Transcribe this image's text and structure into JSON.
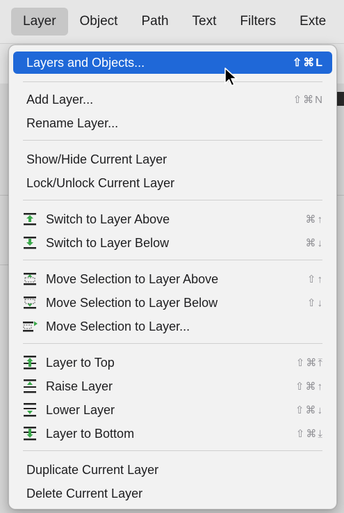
{
  "menubar": {
    "items": [
      "Layer",
      "Object",
      "Path",
      "Text",
      "Filters",
      "Exte"
    ]
  },
  "menu": {
    "items": [
      {
        "label": "Layers and Objects...",
        "shortcut": "⇧⌘L",
        "icon": ""
      },
      {
        "label": "Add Layer...",
        "shortcut": "⇧⌘N",
        "icon": ""
      },
      {
        "label": "Rename Layer...",
        "shortcut": "",
        "icon": ""
      },
      {
        "label": "Show/Hide Current Layer",
        "shortcut": "",
        "icon": ""
      },
      {
        "label": "Lock/Unlock Current Layer",
        "shortcut": "",
        "icon": ""
      },
      {
        "label": "Switch to Layer Above",
        "shortcut": "⌘↑",
        "icon": "layer-up-icon"
      },
      {
        "label": "Switch to Layer Below",
        "shortcut": "⌘↓",
        "icon": "layer-down-icon"
      },
      {
        "label": "Move Selection to Layer Above",
        "shortcut": "⇧↑",
        "icon": "move-selection-up-icon"
      },
      {
        "label": "Move Selection to Layer Below",
        "shortcut": "⇧↓",
        "icon": "move-selection-down-icon"
      },
      {
        "label": "Move Selection to Layer...",
        "shortcut": "",
        "icon": "move-selection-icon"
      },
      {
        "label": "Layer to Top",
        "shortcut": "⇧⌘⤒",
        "icon": "layer-to-top-icon"
      },
      {
        "label": "Raise Layer",
        "shortcut": "⇧⌘↑",
        "icon": "raise-layer-icon"
      },
      {
        "label": "Lower Layer",
        "shortcut": "⇧⌘↓",
        "icon": "lower-layer-icon"
      },
      {
        "label": "Layer to Bottom",
        "shortcut": "⇧⌘⤓",
        "icon": "layer-to-bottom-icon"
      },
      {
        "label": "Duplicate Current Layer",
        "shortcut": "",
        "icon": ""
      },
      {
        "label": "Delete Current Layer",
        "shortcut": "",
        "icon": ""
      }
    ]
  },
  "colors": {
    "highlight": "#1f68d8",
    "icon_green": "#3aa84a"
  },
  "cursor_icon": "arrow-cursor-icon"
}
